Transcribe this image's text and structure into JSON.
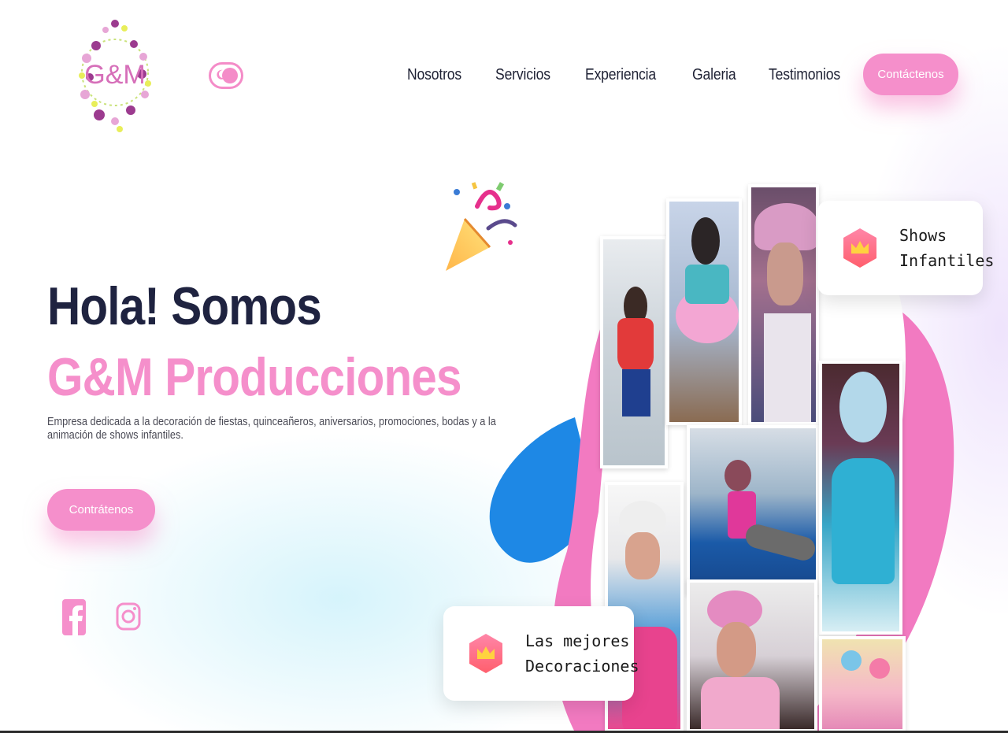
{
  "header": {
    "logo_text": "G&M",
    "nav": [
      "Nosotros",
      "Servicios",
      "Experiencia",
      "Galeria",
      "Testimonios"
    ],
    "contact_button": "Contáctenos"
  },
  "hero": {
    "title": "Hola! Somos",
    "brand": "G&M Producciones",
    "description": "Empresa dedicada a la decoración de fiestas, quinceañeros, aniversarios, promociones, bodas y a la animación de shows infantiles.",
    "cta_button": "Contrátenos"
  },
  "social": {
    "facebook_icon": "facebook-icon",
    "instagram_icon": "instagram-icon"
  },
  "badges": {
    "shows": {
      "line1": "Shows",
      "line2": "Infantiles",
      "icon": "crown-icon"
    },
    "decoraciones": {
      "line1": "Las mejores",
      "line2": "Decoraciones",
      "icon": "crown-icon"
    }
  },
  "colors": {
    "accent_pink": "#f58fcb",
    "dark_text": "#1f2340",
    "blob_blue": "#1e88e5",
    "blob_pink": "#f27ac1"
  }
}
